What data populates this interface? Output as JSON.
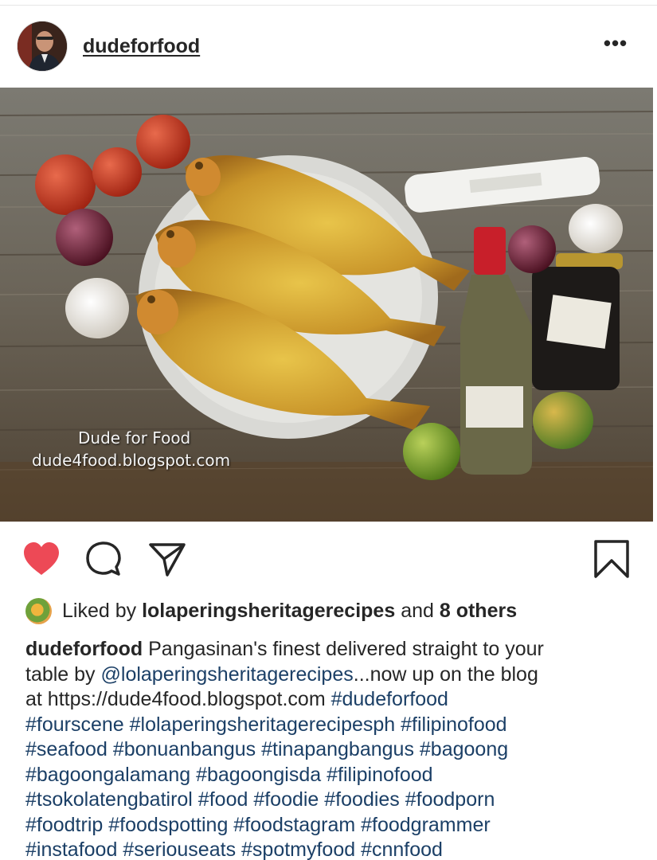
{
  "header": {
    "username": "dudeforfood",
    "more_icon": "more-horizontal-icon",
    "more_label": "•••"
  },
  "photo": {
    "watermark_name": "Dude for Food",
    "watermark_url": "dude4food.blogspot.com"
  },
  "actions": {
    "like_icon": "heart-filled-icon",
    "comment_icon": "comment-icon",
    "share_icon": "paper-plane-icon",
    "save_icon": "bookmark-icon",
    "like_color": "#ed4956"
  },
  "likes": {
    "prefix": "Liked by ",
    "user": "lolaperingsheritagerecipes",
    "middle": " and ",
    "others": "8 others"
  },
  "caption": {
    "author": "dudeforfood",
    "line1_text": " Pangasinan's finest delivered straight to your",
    "line2_prefix": "table by ",
    "line2_mention": "@lolaperingsheritagerecipes",
    "line2_suffix": "...now up on the blog",
    "line3_text": "at https://dude4food.blogspot.com ",
    "line3_tag": "#dudeforfood",
    "line4": "#fourscene #lolaperingsheritagerecipesph #filipinofood",
    "line5": "#seafood #bonuanbangus #tinapangbangus #bagoong",
    "line6": "#bagoongalamang #bagoongisda #filipinofood",
    "line7": "#tsokolatengbatirol #food #foodie #foodies #foodporn",
    "line8": "#foodtrip #foodspotting #foodstagram #foodgrammer",
    "line9": "#instafood #seriouseats #spotmyfood #cnnfood"
  }
}
